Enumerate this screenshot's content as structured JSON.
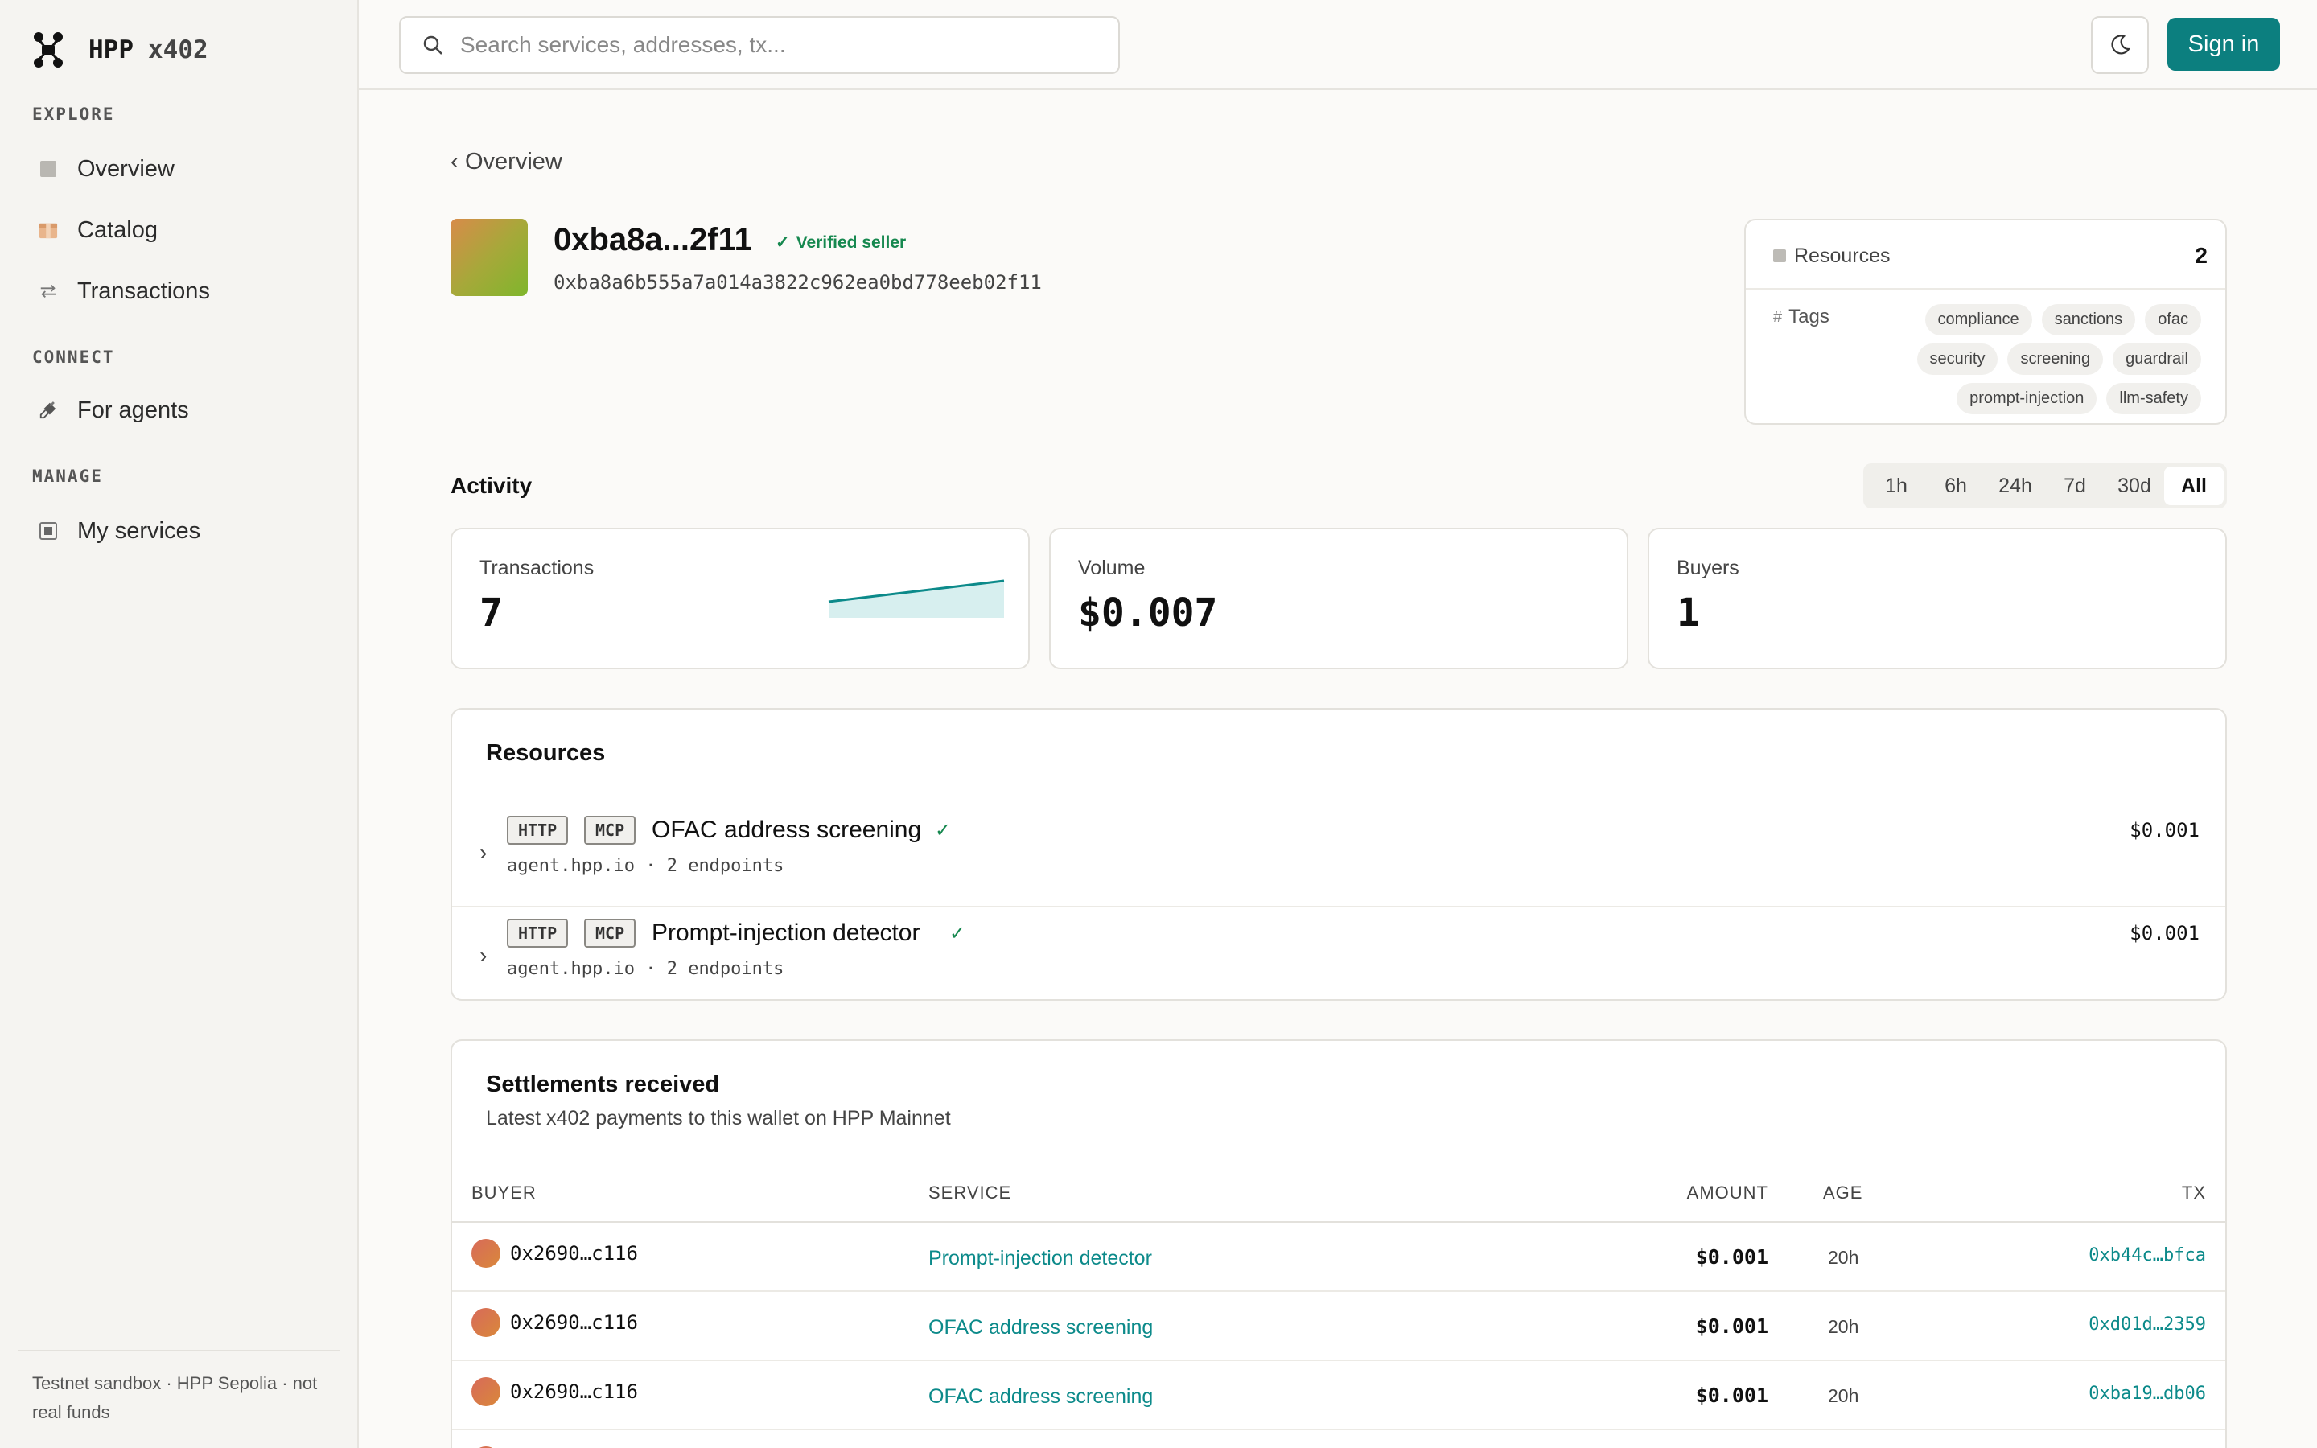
{
  "brand": {
    "name": "HPP",
    "suffix": "x402"
  },
  "sidebar": {
    "sections": [
      {
        "label": "EXPLORE"
      },
      {
        "label": "CONNECT"
      },
      {
        "label": "MANAGE"
      }
    ],
    "items": [
      {
        "label": "Overview",
        "icon": "square-icon"
      },
      {
        "label": "Catalog",
        "icon": "box-icon"
      },
      {
        "label": "Transactions",
        "icon": "swap-arrows-icon"
      },
      {
        "label": "For agents",
        "icon": "plug-icon"
      },
      {
        "label": "My services",
        "icon": "service-icon"
      }
    ],
    "footer": "Testnet sandbox · HPP Sepolia · not real funds"
  },
  "topbar": {
    "search_placeholder": "Search services, addresses, tx...",
    "signin_label": "Sign in"
  },
  "header": {
    "back_label": "Overview",
    "wallet_short": "0xba8a...2f11",
    "verified_label": "Verified seller",
    "wallet_full": "0xba8a6b555a7a014a3822c962ea0bd778eeb02f11"
  },
  "resources_card": {
    "resources_label": "Resources",
    "resources_count": "2",
    "tags_label": "Tags",
    "tags": [
      "compliance",
      "sanctions",
      "ofac",
      "security",
      "screening",
      "guardrail",
      "prompt-injection",
      "llm-safety"
    ]
  },
  "activity": {
    "title": "Activity",
    "ranges": [
      "1h",
      "6h",
      "24h",
      "7d",
      "30d",
      "All"
    ],
    "active_range": "All",
    "stats": [
      {
        "label": "Transactions",
        "value": "7"
      },
      {
        "label": "Volume",
        "value": "$0.007"
      },
      {
        "label": "Buyers",
        "value": "1"
      }
    ]
  },
  "resources": {
    "title": "Resources",
    "items": [
      {
        "badges": [
          "HTTP",
          "MCP"
        ],
        "name": "OFAC address screening",
        "host": "agent.hpp.io",
        "endpoints": "2 endpoints",
        "price": "$0.001"
      },
      {
        "badges": [
          "HTTP",
          "MCP"
        ],
        "name": "Prompt-injection detector",
        "host": "agent.hpp.io",
        "endpoints": "2 endpoints",
        "price": "$0.001"
      }
    ]
  },
  "settlements": {
    "title": "Settlements received",
    "subtitle": "Latest x402 payments to this wallet on HPP Mainnet",
    "columns": {
      "buyer": "BUYER",
      "service": "SERVICE",
      "amount": "AMOUNT",
      "age": "AGE",
      "tx": "TX"
    },
    "rows": [
      {
        "buyer": "0x2690…c116",
        "service": "Prompt-injection detector",
        "amount": "$0.001",
        "age": "20h",
        "tx": "0xb44c…bfca"
      },
      {
        "buyer": "0x2690…c116",
        "service": "OFAC address screening",
        "amount": "$0.001",
        "age": "20h",
        "tx": "0xd01d…2359"
      },
      {
        "buyer": "0x2690…c116",
        "service": "OFAC address screening",
        "amount": "$0.001",
        "age": "20h",
        "tx": "0xba19…db06"
      }
    ]
  },
  "colors": {
    "accent": "#0c7f7f",
    "verified": "#16884f",
    "link": "#0c8a8a"
  }
}
